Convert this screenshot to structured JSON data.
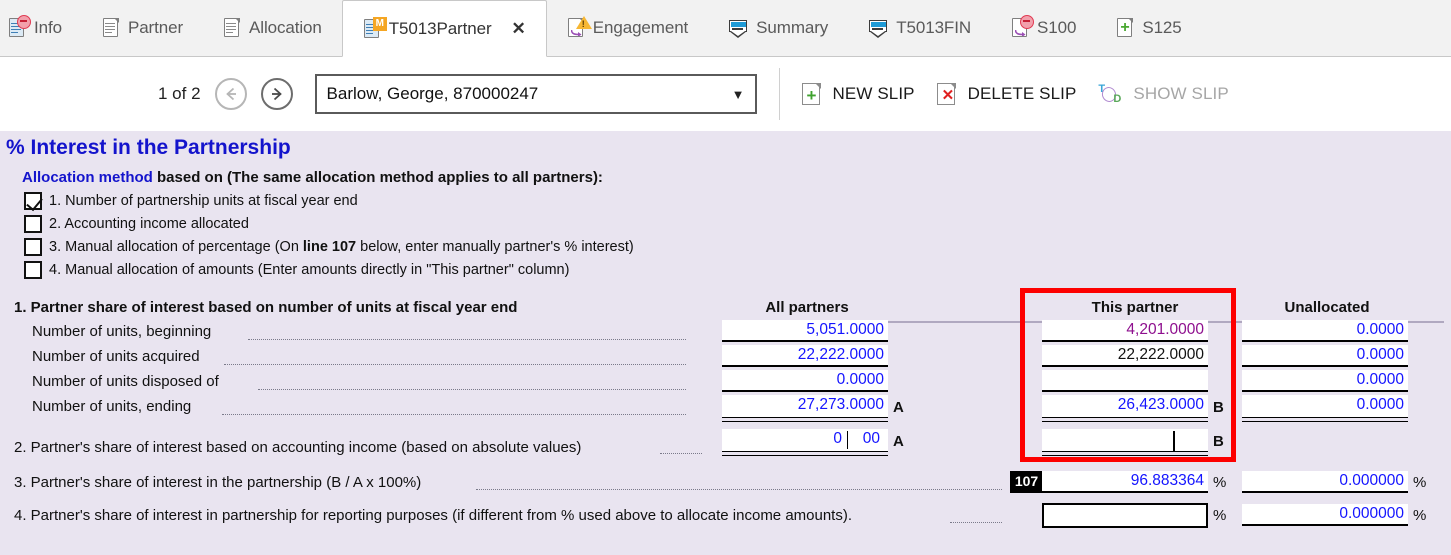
{
  "tabs": [
    {
      "label": "Info",
      "icon": "document-minus-icon",
      "active": false,
      "closable": false
    },
    {
      "label": "Partner",
      "icon": "document-icon",
      "active": false,
      "closable": false
    },
    {
      "label": "Allocation",
      "icon": "document-icon",
      "active": false,
      "closable": false
    },
    {
      "label": "T5013Partner",
      "icon": "document-modified-icon",
      "active": true,
      "closable": true,
      "close_label": "✕"
    },
    {
      "label": "Engagement",
      "icon": "document-warning-icon",
      "active": false,
      "closable": false
    },
    {
      "label": "Summary",
      "icon": "shield-icon",
      "active": false,
      "closable": false
    },
    {
      "label": "T5013FIN",
      "icon": "shield-icon",
      "active": false,
      "closable": false
    },
    {
      "label": "S100",
      "icon": "document-minus-icon",
      "active": false,
      "closable": false
    },
    {
      "label": "S125",
      "icon": "document-plus-icon",
      "active": false,
      "closable": false
    }
  ],
  "toolbar": {
    "pager_text": "1 of 2",
    "prev_label": "←",
    "next_label": "→",
    "partner_select_value": "Barlow, George, 870000247",
    "dropdown_caret": "▼",
    "new_slip_label": "NEW SLIP",
    "delete_slip_label": "DELETE SLIP",
    "show_slip_label": "SHOW SLIP"
  },
  "form": {
    "title": "% Interest in the Partnership",
    "alloc_head_blue": "Allocation method",
    "alloc_head_rest": " based on (The same allocation method applies to all partners):",
    "checkboxes": [
      {
        "checked": true,
        "label": "1. Number of partnership units at fiscal year end"
      },
      {
        "checked": false,
        "label": "2. Accounting income allocated"
      },
      {
        "checked": false,
        "label": "3. Manual allocation of percentage (On ",
        "bold": "line 107",
        "label2": " below, enter manually partner's % interest)"
      },
      {
        "checked": false,
        "label": "4. Manual allocation of amounts (Enter amounts directly in \"This partner\" column)"
      }
    ],
    "section1_title": "1. Partner share of interest based on number of units at fiscal year end",
    "col_headers": {
      "all_partners": "All partners",
      "this_partner": "This partner",
      "unallocated": "Unallocated"
    },
    "rows": [
      {
        "label": "Number of units, beginning",
        "all": "5,051.0000",
        "this": "4,201.0000",
        "this_color": "purple",
        "unalloc": "0.0000"
      },
      {
        "label": "Number of units acquired",
        "all": "22,222.0000",
        "this": "22,222.0000",
        "this_color": "black",
        "unalloc": "0.0000"
      },
      {
        "label": "Number of units disposed of",
        "all": "0.0000",
        "this": "",
        "this_color": "blue",
        "unalloc": "0.0000"
      },
      {
        "label": "Number of units, ending",
        "all": "27,273.0000",
        "this": "26,423.0000",
        "this_color": "blue",
        "unalloc": "0.0000",
        "all_tag": "A",
        "this_tag": "B"
      }
    ],
    "line2": {
      "label": "2. Partner's share of interest based on accounting income (based on absolute values)",
      "all_int": "0",
      "all_dec": "00",
      "all_tag": "A",
      "this": "",
      "this_tag": "B"
    },
    "line3": {
      "label": "3. Partner's share of interest in the partnership (B / A x 100%)",
      "line_number": "107",
      "this": "96.883364",
      "unalloc": "0.000000",
      "percent": "%"
    },
    "line4": {
      "label": "4. Partner's share of interest in partnership for reporting purposes (if different from % used above to allocate income amounts).",
      "this": "",
      "unalloc": "0.000000",
      "percent": "%"
    }
  },
  "colors": {
    "form_background": "#e9e4f0",
    "title_blue": "#1414cc",
    "value_blue": "#1414ff",
    "value_purple": "#8e0f8e",
    "highlight_red": "#fd0000"
  }
}
